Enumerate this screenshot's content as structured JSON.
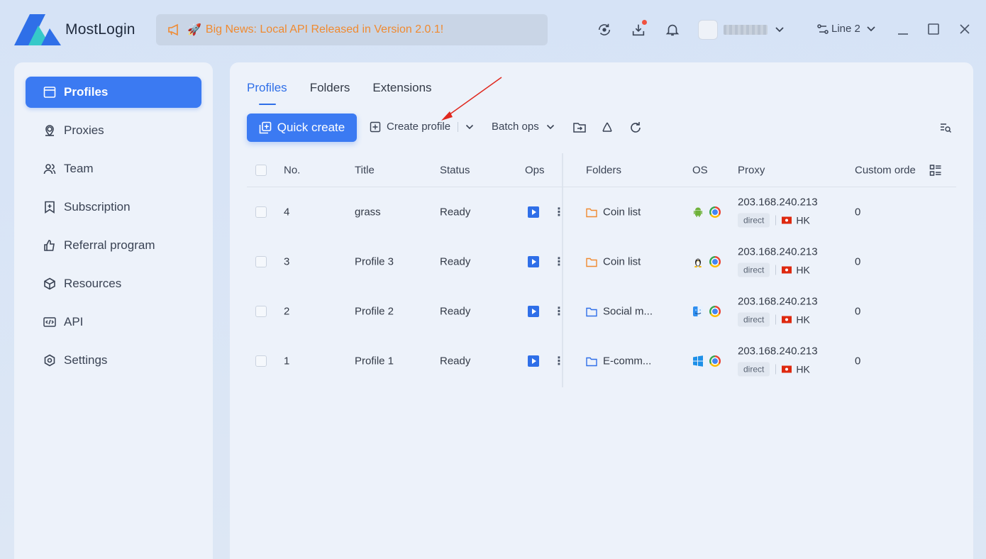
{
  "app": {
    "name": "MostLogin"
  },
  "news": {
    "text": "Big News: Local API Released in Version 2.0.1!",
    "rocket": "🚀"
  },
  "topbar": {
    "line_label": "Line 2"
  },
  "sidebar": {
    "items": [
      {
        "label": "Profiles",
        "icon": "window-icon",
        "active": true
      },
      {
        "label": "Proxies",
        "icon": "location-pin-icon"
      },
      {
        "label": "Team",
        "icon": "users-icon"
      },
      {
        "label": "Subscription",
        "icon": "bookmark-plus-icon"
      },
      {
        "label": "Referral program",
        "icon": "thumbs-up-icon"
      },
      {
        "label": "Resources",
        "icon": "cube-icon"
      },
      {
        "label": "API",
        "icon": "code-icon"
      },
      {
        "label": "Settings",
        "icon": "gear-icon"
      }
    ]
  },
  "tabs": [
    {
      "label": "Profiles",
      "active": true
    },
    {
      "label": "Folders"
    },
    {
      "label": "Extensions"
    }
  ],
  "toolbar": {
    "quick_create": "Quick create",
    "create_profile": "Create profile",
    "batch_ops": "Batch ops"
  },
  "table": {
    "headers": {
      "no": "No.",
      "title": "Title",
      "status": "Status",
      "ops": "Ops",
      "folders": "Folders",
      "os": "OS",
      "proxy": "Proxy",
      "custom_order": "Custom orde"
    },
    "rows": [
      {
        "no": "4",
        "title": "grass",
        "status": "Ready",
        "folder": "Coin list",
        "folder_color": "#f08a30",
        "os": "android-icon",
        "ip": "203.168.240.213",
        "proxy_type": "direct",
        "country": "HK",
        "order": "0"
      },
      {
        "no": "3",
        "title": "Profile 3",
        "status": "Ready",
        "folder": "Coin list",
        "folder_color": "#f08a30",
        "os": "linux-icon",
        "ip": "203.168.240.213",
        "proxy_type": "direct",
        "country": "HK",
        "order": "0"
      },
      {
        "no": "2",
        "title": "Profile 2",
        "status": "Ready",
        "folder": "Social m...",
        "folder_color": "#2f6fe8",
        "os": "macos-icon",
        "ip": "203.168.240.213",
        "proxy_type": "direct",
        "country": "HK",
        "order": "0"
      },
      {
        "no": "1",
        "title": "Profile 1",
        "status": "Ready",
        "folder": "E-comm...",
        "folder_color": "#2f6fe8",
        "os": "windows-icon",
        "ip": "203.168.240.213",
        "proxy_type": "direct",
        "country": "HK",
        "order": "0"
      }
    ]
  },
  "colors": {
    "accent": "#3b7af2",
    "news_text": "#f08a30",
    "annotation_arrow": "#e0281e"
  }
}
